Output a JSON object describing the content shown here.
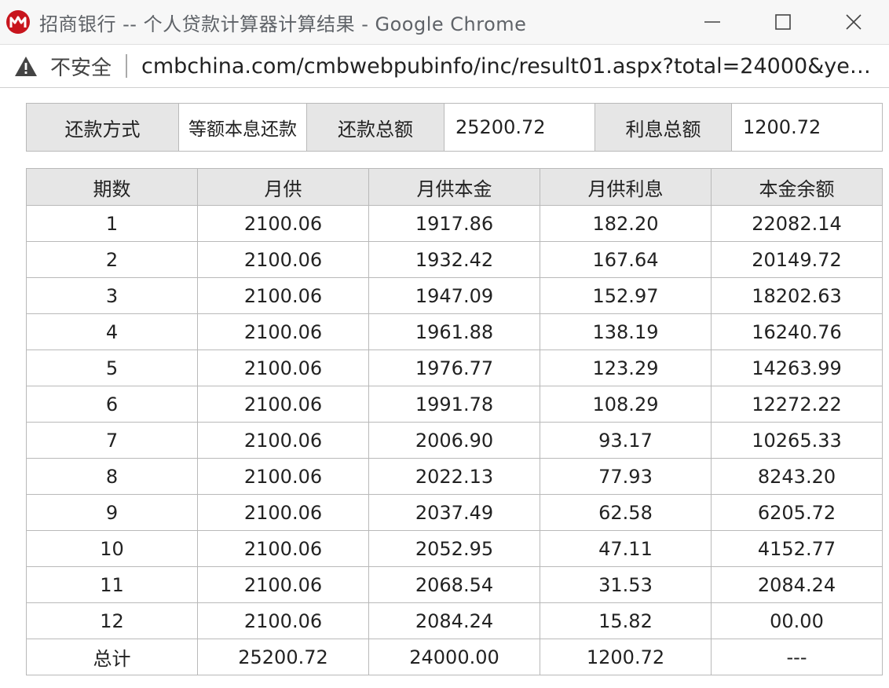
{
  "window": {
    "title": "招商银行 -- 个人贷款计算器计算结果 - Google Chrome",
    "minimize_icon": "minimize-icon",
    "maximize_icon": "maximize-icon",
    "close_icon": "close-icon"
  },
  "address_bar": {
    "security_label": "不安全",
    "url": "cmbchina.com/cmbwebpubinfo/inc/result01.aspx?total=24000&yea...",
    "warning_icon": "warning-icon"
  },
  "summary": {
    "method_label": "还款方式",
    "method_value": "等额本息还款",
    "total_label": "还款总额",
    "total_value": "25200.72",
    "interest_label": "利息总额",
    "interest_value": "1200.72"
  },
  "schedule": {
    "headers": [
      "期数",
      "月供",
      "月供本金",
      "月供利息",
      "本金余额"
    ],
    "rows": [
      [
        "1",
        "2100.06",
        "1917.86",
        "182.20",
        "22082.14"
      ],
      [
        "2",
        "2100.06",
        "1932.42",
        "167.64",
        "20149.72"
      ],
      [
        "3",
        "2100.06",
        "1947.09",
        "152.97",
        "18202.63"
      ],
      [
        "4",
        "2100.06",
        "1961.88",
        "138.19",
        "16240.76"
      ],
      [
        "5",
        "2100.06",
        "1976.77",
        "123.29",
        "14263.99"
      ],
      [
        "6",
        "2100.06",
        "1991.78",
        "108.29",
        "12272.22"
      ],
      [
        "7",
        "2100.06",
        "2006.90",
        "93.17",
        "10265.33"
      ],
      [
        "8",
        "2100.06",
        "2022.13",
        "77.93",
        "8243.20"
      ],
      [
        "9",
        "2100.06",
        "2037.49",
        "62.58",
        "6205.72"
      ],
      [
        "10",
        "2100.06",
        "2052.95",
        "47.11",
        "4152.77"
      ],
      [
        "11",
        "2100.06",
        "2068.54",
        "31.53",
        "2084.24"
      ],
      [
        "12",
        "2100.06",
        "2084.24",
        "15.82",
        "00.00"
      ],
      [
        "总计",
        "25200.72",
        "24000.00",
        "1200.72",
        "---"
      ]
    ]
  },
  "colors": {
    "brand_red": "#c8151d",
    "header_gray": "#e6e6e6",
    "border": "#b9b9b9"
  }
}
